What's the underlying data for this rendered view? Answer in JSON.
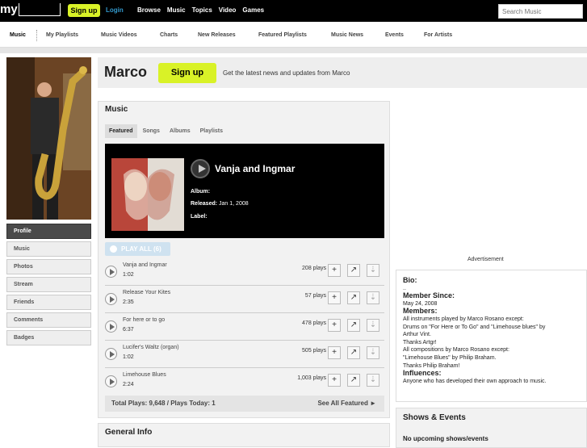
{
  "topbar": {
    "logo": "my",
    "signup": "Sign up",
    "login": "Login",
    "nav": [
      "Browse",
      "Music",
      "Topics",
      "Video",
      "Games"
    ],
    "search_placeholder": "Search Music"
  },
  "subnav": {
    "items": [
      "Music",
      "My Playlists",
      "Music Videos",
      "Charts",
      "New Releases",
      "Featured Playlists",
      "Music News",
      "Events",
      "For Artists"
    ]
  },
  "leftnav": {
    "items": [
      "Profile",
      "Music",
      "Photos",
      "Stream",
      "Friends",
      "Comments",
      "Badges"
    ]
  },
  "header": {
    "name": "Marco",
    "signup": "Sign up",
    "tagline": "Get the latest news and updates from Marco"
  },
  "music": {
    "title": "Music",
    "tabs": [
      "Featured",
      "Songs",
      "Albums",
      "Playlists"
    ],
    "featured": {
      "label": "",
      "song": "Vanja and Ingmar",
      "album_label": "Album:",
      "album": "",
      "released_label": "Released:",
      "released": "Jan 1, 2008",
      "label_label": "Label:"
    },
    "play_all": "PLAY ALL (6)",
    "tracks": [
      {
        "name": "Vanja and Ingmar",
        "duration": "1:02",
        "plays": "208 plays"
      },
      {
        "name": "Release Your Kites",
        "duration": "2:35",
        "plays": "57 plays"
      },
      {
        "name": "For here or to go",
        "duration": "6:37",
        "plays": "478 plays"
      },
      {
        "name": "Lucifer's Waltz (organ)",
        "duration": "1:02",
        "plays": "505 plays"
      },
      {
        "name": "Limehouse Blues",
        "duration": "2:24",
        "plays": "1,003 plays"
      }
    ],
    "totals": "Total Plays: 9,648 / Plays Today: 1",
    "see_all": "See All Featured ►"
  },
  "general_info": {
    "title": "General Info"
  },
  "sidebar": {
    "ad_label": "Advertisement",
    "bio_heading": "Bio:",
    "bio_text": "..",
    "member_heading": "Member Since:",
    "member_since": "May 24, 2008",
    "members_heading": "Members:",
    "members_lines": [
      "All instruments played by Marco Rosano except:",
      "Drums on \"For Here or To Go\" and \"Limehouse blues\" by",
      "Arthur Vint.",
      "Thanks Artgr!",
      "All compositions by Marco Rosano except:",
      "\"Limehouse Blues\" by Philip Braham.",
      "Thanks Philip Braham!"
    ],
    "influences_heading": "Influences:",
    "influences": "Anyone who has developed their own approach to music.",
    "shows_title": "Shows & Events",
    "no_shows": "No upcoming shows/events"
  }
}
